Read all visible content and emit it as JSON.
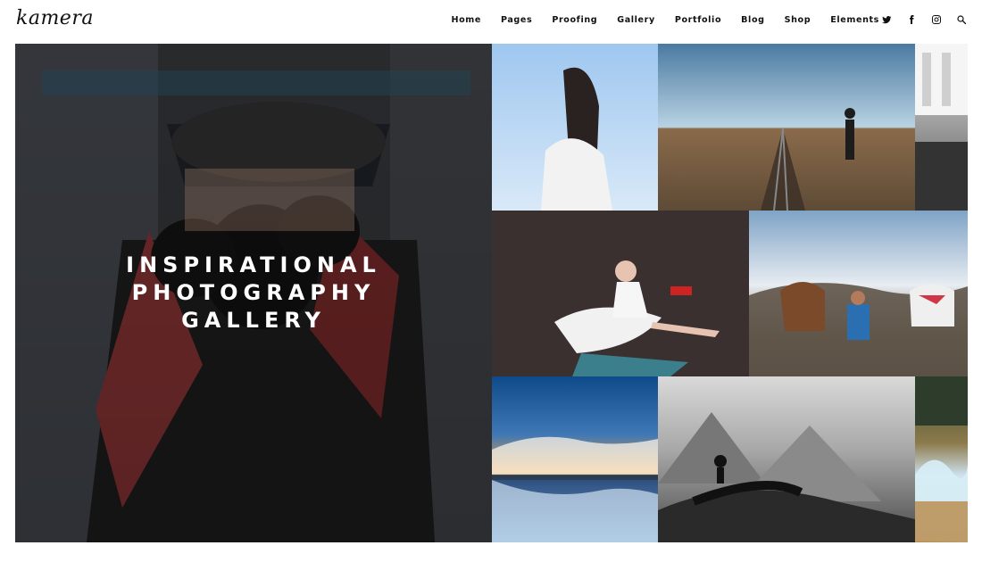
{
  "header": {
    "logo": "kamera",
    "nav": [
      "Home",
      "Pages",
      "Proofing",
      "Gallery",
      "Portfolio",
      "Blog",
      "Shop",
      "Elements"
    ],
    "icons": [
      "twitter-icon",
      "facebook-icon",
      "instagram-icon",
      "search-icon"
    ]
  },
  "hero": {
    "line1": "INSPIRATIONAL",
    "line2": "PHOTOGRAPHY",
    "line3": "GALLERY"
  },
  "gallery": {
    "tiles": [
      {
        "name": "woman-hair-wind-photo"
      },
      {
        "name": "railroad-walker-photo"
      },
      {
        "name": "building-bw-photo"
      },
      {
        "name": "ballerina-photo"
      },
      {
        "name": "horses-mountain-photo"
      },
      {
        "name": "sunset-reflection-photo"
      },
      {
        "name": "mountain-jump-bw-photo"
      },
      {
        "name": "smoke-field-photo"
      }
    ]
  },
  "colors": {
    "text": "#111111",
    "background": "#ffffff",
    "hero_text": "#ffffff"
  }
}
